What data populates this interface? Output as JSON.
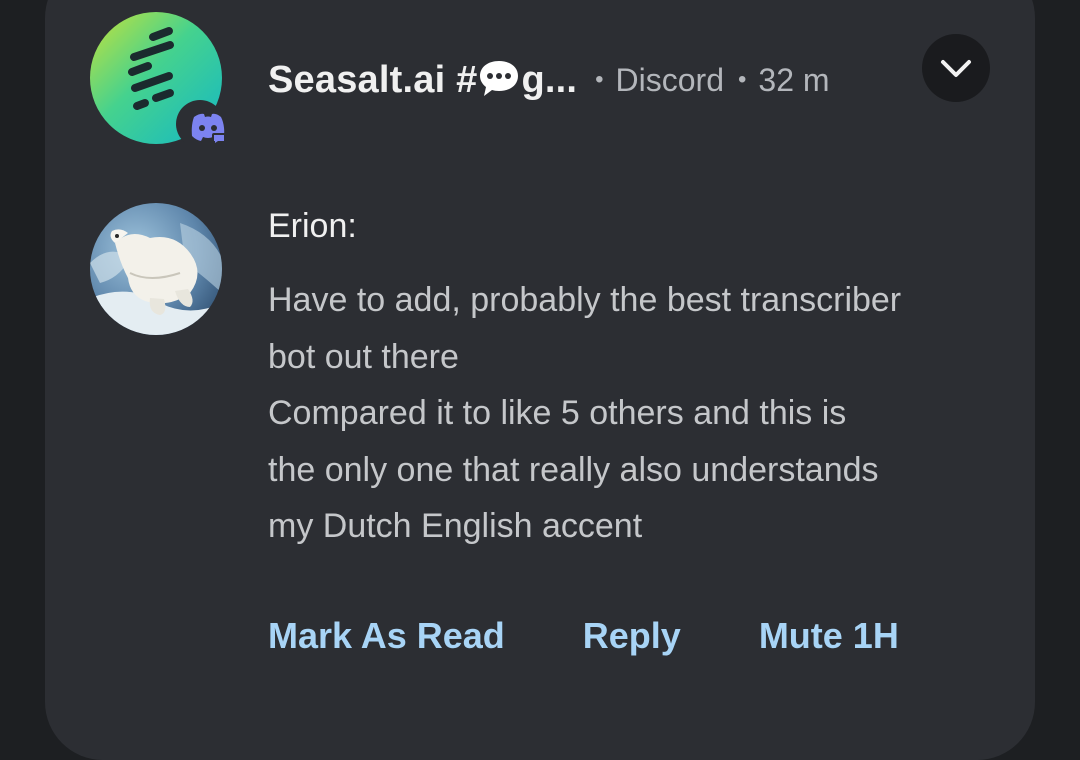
{
  "notification": {
    "title_prefix": "Seasalt.ai #",
    "title_suffix": "g...",
    "app": "Discord",
    "time": "32 m",
    "separator": "•",
    "app_icon": "seasalt-logo-icon",
    "badge_icon": "discord-icon",
    "expand_icon": "chevron-down-icon"
  },
  "message": {
    "sender": "Erion:",
    "lines": [
      "Have to add, probably the best transcriber",
      "bot out there",
      "Compared it to like 5 others and this is",
      "the only one that really also understands",
      "my Dutch English accent"
    ]
  },
  "actions": {
    "mark_read": "Mark As Read",
    "reply": "Reply",
    "mute": "Mute 1H"
  },
  "colors": {
    "background": "#1d1f22",
    "card": "#2c2e33",
    "action": "#a8d4f6",
    "discord": "#7c83f0"
  }
}
